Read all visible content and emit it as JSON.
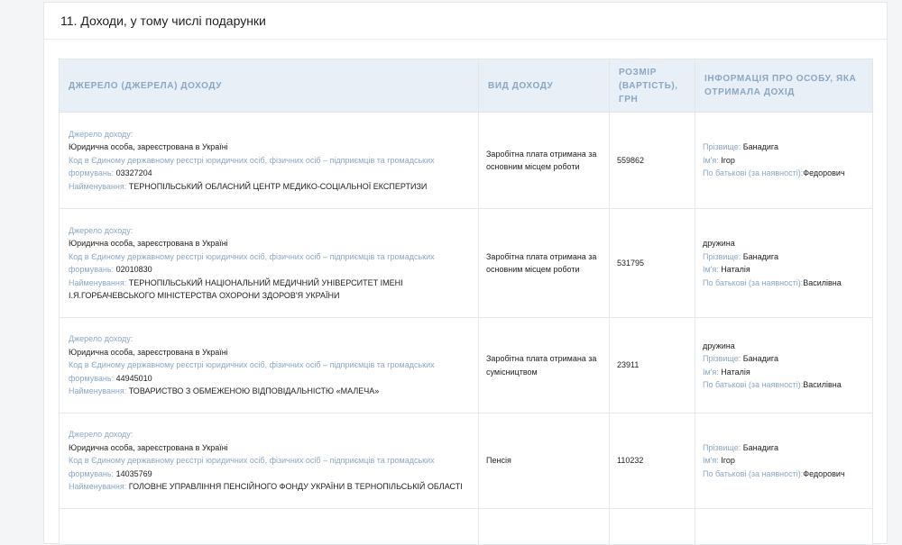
{
  "section": {
    "title": "11. Доходи, у тому числі подарунки"
  },
  "table": {
    "headers": {
      "source": "Джерело (джерела) доходу",
      "type": "Вид доходу",
      "amount": "Розмір (вартість), грн",
      "person": "Інформація про особу, яка отримала дохід"
    },
    "labels": {
      "source": "Джерело доходу:",
      "code": "Код в Єдиному державному реєстрі юридичних осіб, фізичних осіб – підприємців та громадських формувань:",
      "name": "Найменування:",
      "surname": "Прізвище:",
      "firstname": "Ім'я:",
      "patronymic": "По батькові (за наявності):"
    },
    "rows": [
      {
        "entity": "Юридична особа, зареєстрована в Україні",
        "code": "03327204",
        "name": "ТЕРНОПІЛЬСЬКИЙ ОБЛАСНИЙ ЦЕНТР МЕДИКО-СОЦІАЛЬНОЇ ЕКСПЕРТИЗИ",
        "type": "Заробітна плата отримана за основним місцем роботи",
        "amount": "559862",
        "relation": "",
        "surname": "Банадига",
        "firstname": "Ігор",
        "patronymic": "Федорович"
      },
      {
        "entity": "Юридична особа, зареєстрована в Україні",
        "code": "02010830",
        "name": "ТЕРНОПІЛЬСЬКИЙ НАЦІОНАЛЬНИЙ МЕДИЧНИЙ УНІВЕРСИТЕТ ІМЕНІ І.Я.ГОРБАЧЕВСЬКОГО МІНІСТЕРСТВА ОХОРОНИ ЗДОРОВ'Я УКРАЇНИ",
        "type": "Заробітна плата отримана за основним місцем роботи",
        "amount": "531795",
        "relation": "дружина",
        "surname": "Банадига",
        "firstname": "Наталія",
        "patronymic": "Василівна"
      },
      {
        "entity": "Юридична особа, зареєстрована в Україні",
        "code": "44945010",
        "name": "ТОВАРИСТВО З ОБМЕЖЕНОЮ ВІДПОВІДАЛЬНІСТЮ «МАЛЕЧА»",
        "type": "Заробітна плата отримана за сумісництвом",
        "amount": "23911",
        "relation": "дружина",
        "surname": "Банадига",
        "firstname": "Наталія",
        "patronymic": "Василівна"
      },
      {
        "entity": "Юридична особа, зареєстрована в Україні",
        "code": "14035769",
        "name": "ГОЛОВНЕ УПРАВЛІННЯ ПЕНСІЙНОГО ФОНДУ УКРАЇНИ В ТЕРНОПІЛЬСЬКІЙ ОБЛАСТІ",
        "type": "Пенсія",
        "amount": "110232",
        "relation": "",
        "surname": "Банадига",
        "firstname": "Ігор",
        "patronymic": "Федорович"
      }
    ]
  }
}
